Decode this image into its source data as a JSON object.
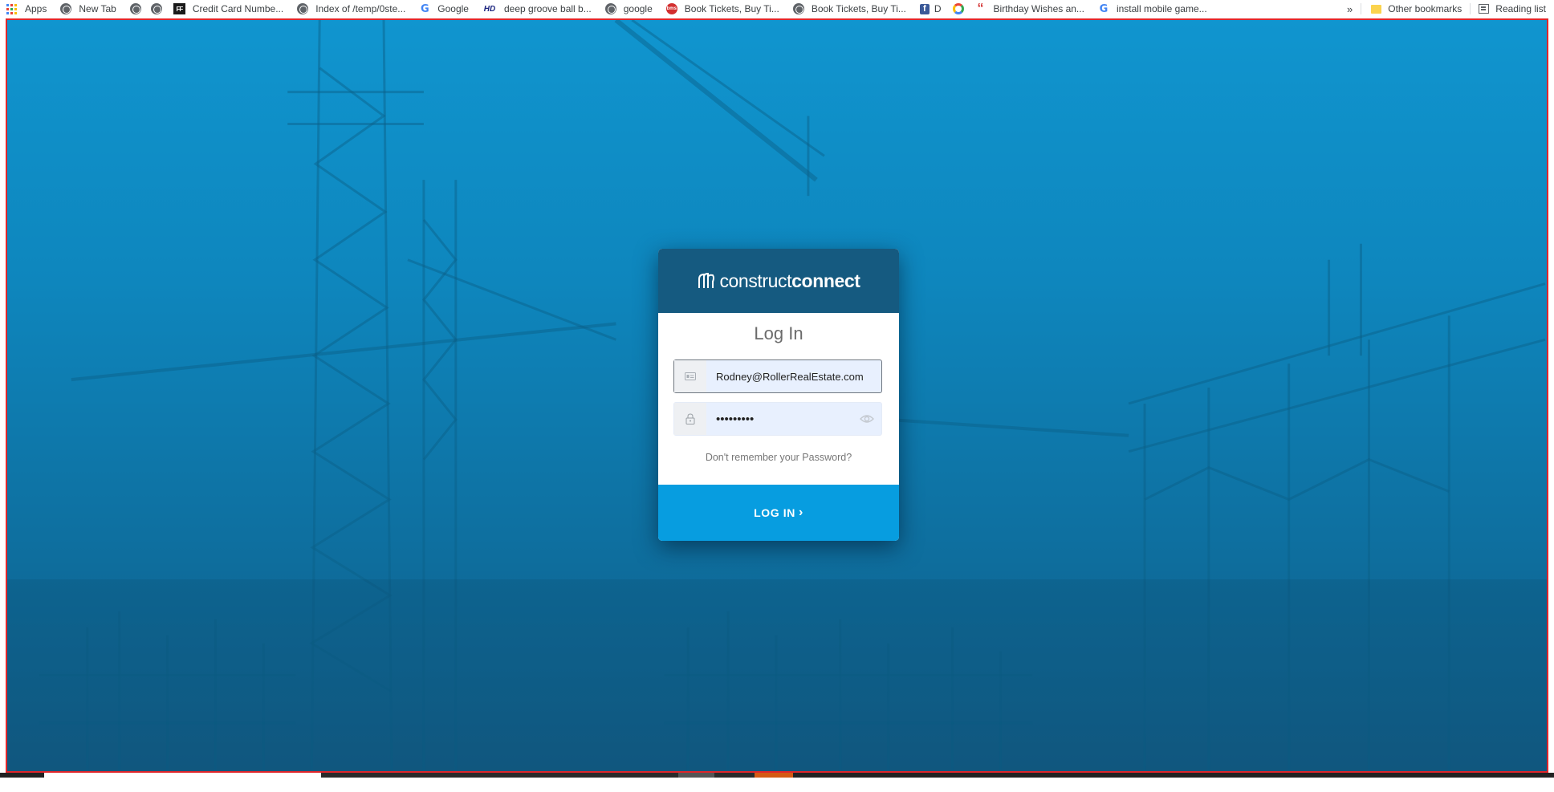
{
  "bookmarks": {
    "items": [
      {
        "label": "Apps",
        "icon": "apps-grid-icon"
      },
      {
        "label": "New Tab",
        "icon": "globe-icon"
      },
      {
        "label": "",
        "icon": "globe-icon"
      },
      {
        "label": "",
        "icon": "globe-icon"
      },
      {
        "label": "Credit Card Numbe...",
        "icon": "ff-icon"
      },
      {
        "label": "Index of /temp/0ste...",
        "icon": "globe-icon"
      },
      {
        "label": "Google",
        "icon": "google-icon"
      },
      {
        "label": "deep groove ball b...",
        "icon": "hd-icon"
      },
      {
        "label": "google",
        "icon": "globe-icon"
      },
      {
        "label": "Book Tickets, Buy Ti...",
        "icon": "bookmyshow-icon"
      },
      {
        "label": "Book Tickets, Buy Ti...",
        "icon": "globe-icon"
      },
      {
        "label": "D",
        "icon": "facebook-icon"
      },
      {
        "label": "",
        "icon": "ring-icon"
      },
      {
        "label": "Birthday Wishes an...",
        "icon": "quote-icon"
      },
      {
        "label": "install mobile game...",
        "icon": "google-icon"
      }
    ],
    "more": "»",
    "other_bookmarks": "Other bookmarks",
    "reading_list": "Reading list"
  },
  "login": {
    "brand_light": "construct",
    "brand_bold": "connect",
    "title": "Log In",
    "email_value": "Rodney@RollerRealEstate.com",
    "password_value": "•••••••••",
    "forgot_label": "Don't remember your Password?",
    "submit_label": "LOG IN",
    "submit_chevron": "›"
  },
  "colors": {
    "header": "#155a80",
    "button": "#079de0",
    "background": "#0e86bd",
    "field": "#e8f0fe"
  }
}
